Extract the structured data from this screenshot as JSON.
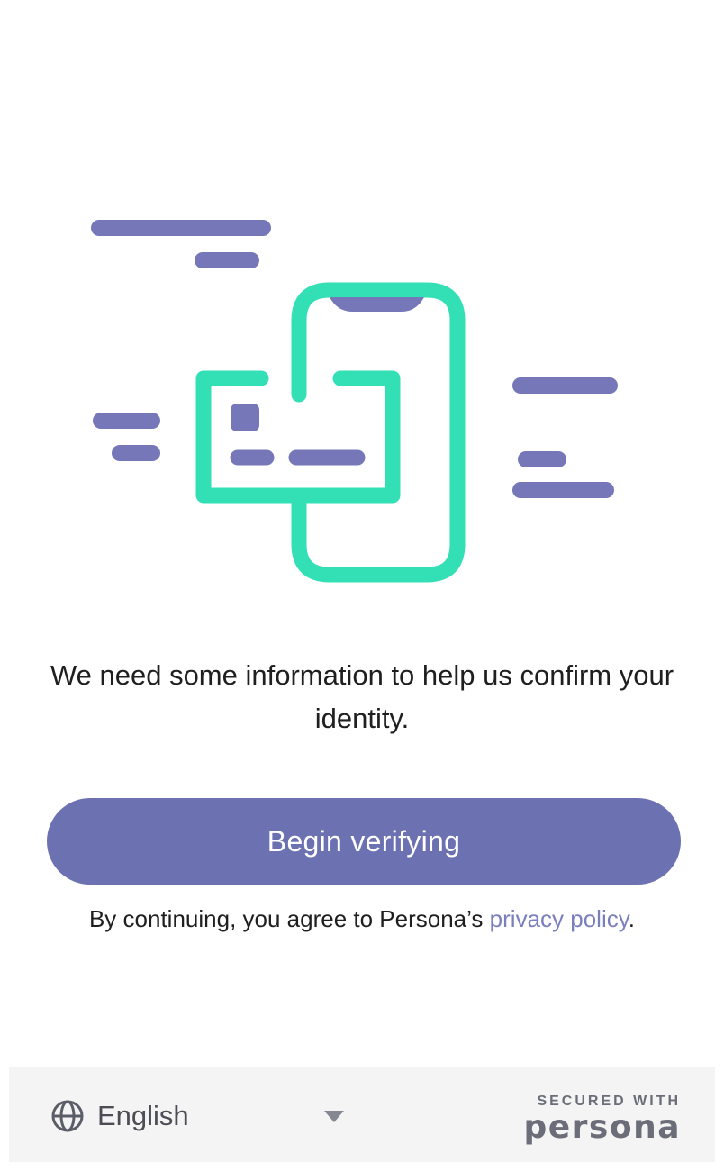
{
  "intro": {
    "text": "We need some information to help us confirm your identity."
  },
  "actions": {
    "begin_label": "Begin verifying"
  },
  "consent": {
    "prefix": "By continuing, you agree to Persona’s ",
    "link_label": "privacy policy",
    "suffix": "."
  },
  "footer": {
    "language": "English",
    "secured_label": "SECURED WITH",
    "brand": "persona"
  },
  "icons": {
    "illustration": "identity-verification-illustration",
    "language": "globe-icon",
    "dropdown": "caret-down-icon"
  },
  "colors": {
    "accent": "#6c71b2",
    "illustration_green": "#33e0b6",
    "illustration_purple": "#7577b8",
    "link": "#7a7fbd",
    "footer_bg": "#f4f4f4"
  }
}
